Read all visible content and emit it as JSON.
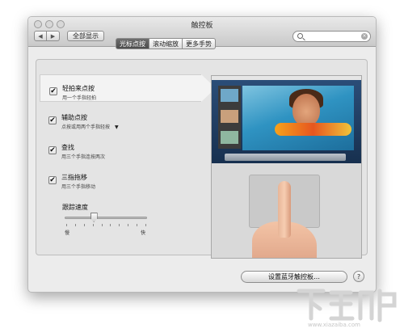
{
  "window": {
    "title": "触控板",
    "nav_back_glyph": "◀",
    "nav_forward_glyph": "▶",
    "show_all": "全部显示",
    "search": {
      "value": "",
      "placeholder": ""
    }
  },
  "tabs": [
    {
      "label": "光标点按",
      "active": true
    },
    {
      "label": "滚动缩放",
      "active": false
    },
    {
      "label": "更多手势",
      "active": false
    }
  ],
  "options": [
    {
      "title": "轻拍来点按",
      "subtitle": "用一个手指轻拍",
      "checked": true,
      "selected": true
    },
    {
      "title": "辅助点按",
      "subtitle": "点按或用两个手指轻按",
      "checked": true,
      "has_dropdown": true
    },
    {
      "title": "查找",
      "subtitle": "用三个手指连按两次",
      "checked": true
    },
    {
      "title": "三指拖移",
      "subtitle": "用三个手指移动",
      "checked": true
    }
  ],
  "tracking_speed": {
    "label": "跟踪速度",
    "slow": "慢",
    "fast": "快",
    "value_fraction": 0.35
  },
  "buttons": {
    "bluetooth": "设置蓝牙触控板…",
    "help": "?"
  },
  "watermark": {
    "url": "www.xiazaiba.com"
  },
  "colors": {
    "tab_active": "#555555",
    "window_bg": "#ececec"
  }
}
